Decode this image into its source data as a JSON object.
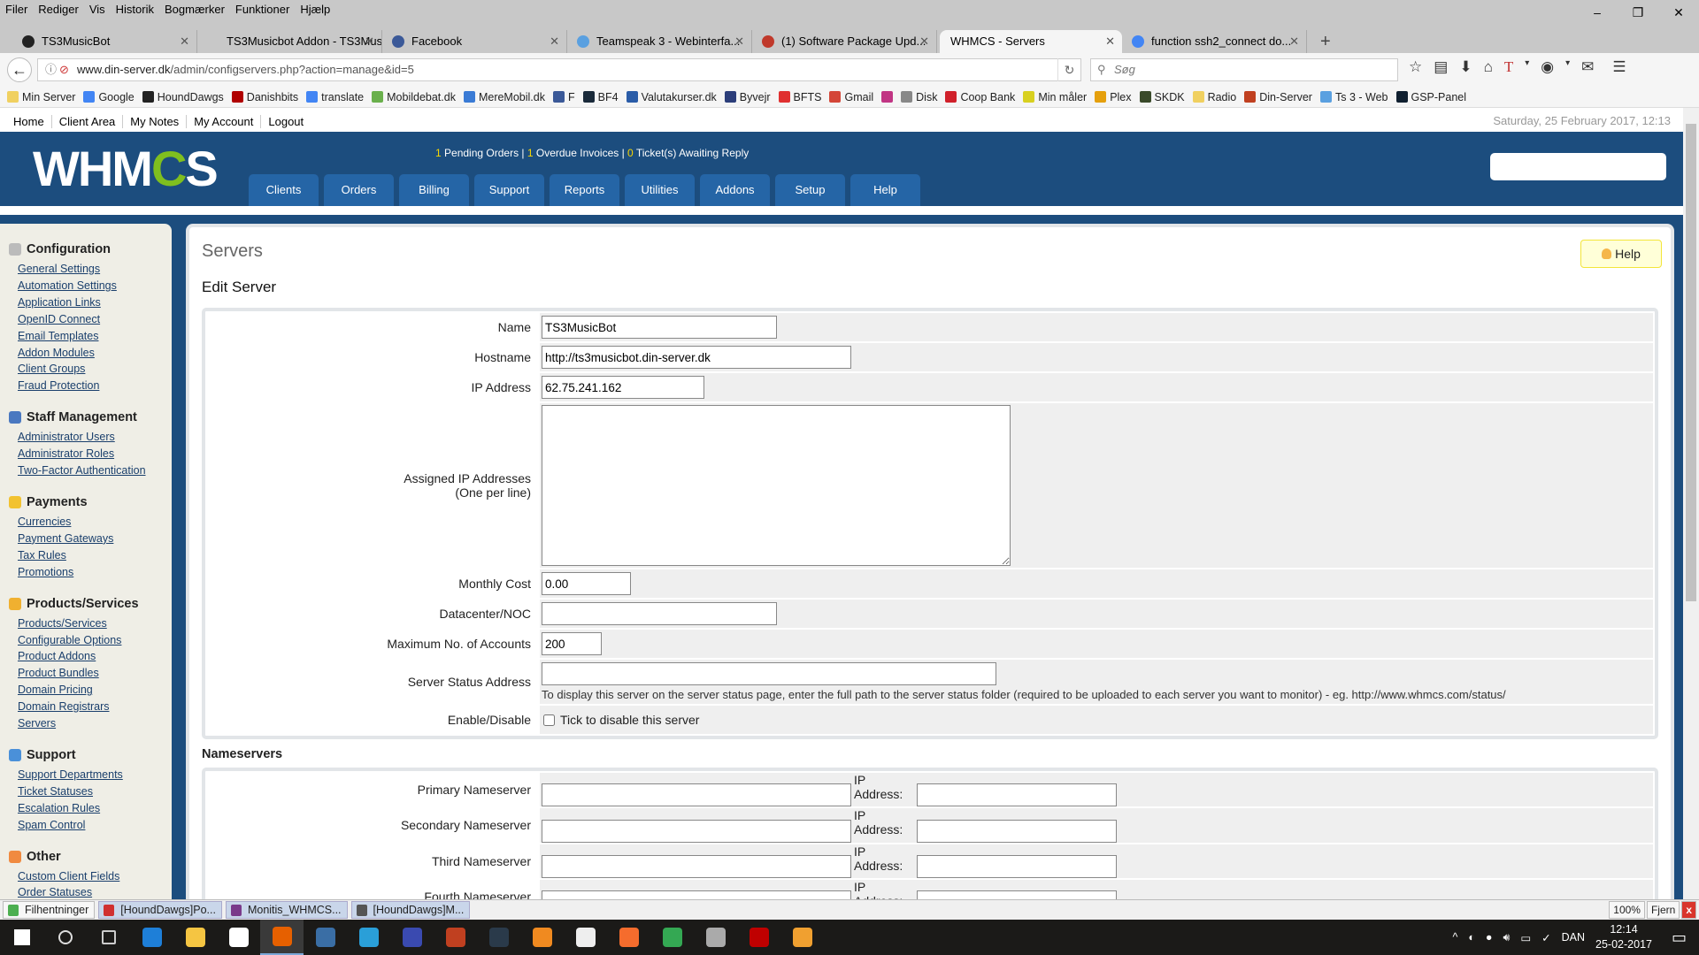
{
  "browser": {
    "menu": [
      "Filer",
      "Rediger",
      "Vis",
      "Historik",
      "Bogmærker",
      "Funktioner",
      "Hjælp"
    ],
    "window_controls": [
      "–",
      "❐",
      "✕"
    ],
    "tabs": [
      {
        "title": "TS3MusicBot",
        "icon": "ts3musicbot-icon",
        "color": "#222222"
      },
      {
        "title": "TS3Musicbot Addon - TS3Mus...",
        "icon": "page-icon",
        "color": "#c8c8c8"
      },
      {
        "title": "Facebook",
        "icon": "facebook-icon",
        "color": "#3b5998"
      },
      {
        "title": "Teamspeak 3 - Webinterfa...",
        "icon": "teamspeak-icon",
        "color": "#5aa0e0"
      },
      {
        "title": "(1) Software Package Upd...",
        "icon": "package-icon",
        "color": "#c0392b"
      },
      {
        "title": "WHMCS - Servers",
        "icon": "",
        "color": "",
        "active": true
      },
      {
        "title": "function ssh2_connect do...",
        "icon": "google-icon",
        "color": "#4285f4"
      }
    ],
    "new_tab": "+",
    "url_domain": "www.din-server.dk",
    "url_path": "/admin/configservers.php?action=manage&id=5",
    "search_placeholder": "Søg",
    "bookmarks": [
      {
        "label": "Min Server",
        "color": "#f0d060"
      },
      {
        "label": "Google",
        "color": "#4285f4"
      },
      {
        "label": "HoundDawgs",
        "color": "#222222"
      },
      {
        "label": "Danishbits",
        "color": "#b00000"
      },
      {
        "label": "translate",
        "color": "#4285f4"
      },
      {
        "label": "Mobildebat.dk",
        "color": "#6ab04c"
      },
      {
        "label": "MereMobil.dk",
        "color": "#3a7bd5"
      },
      {
        "label": "F",
        "color": "#3b5998"
      },
      {
        "label": "BF4",
        "color": "#1a2a3a"
      },
      {
        "label": "Valutakurser.dk",
        "color": "#2a5ca8"
      },
      {
        "label": "Byvejr",
        "color": "#2c3e7a"
      },
      {
        "label": "BFTS",
        "color": "#e03030"
      },
      {
        "label": "Gmail",
        "color": "#d44638"
      },
      {
        "label": "",
        "color": "#c13584"
      },
      {
        "label": "Disk",
        "color": "#888888"
      },
      {
        "label": "Coop Bank",
        "color": "#d0202a"
      },
      {
        "label": "Min måler",
        "color": "#d8d020"
      },
      {
        "label": "Plex",
        "color": "#e5a00d"
      },
      {
        "label": "SKDK",
        "color": "#3a4a2a"
      },
      {
        "label": "Radio",
        "color": "#f0d060"
      },
      {
        "label": "Din-Server",
        "color": "#c04020"
      },
      {
        "label": "Ts 3 - Web",
        "color": "#5aa0e0"
      },
      {
        "label": "GSP-Panel",
        "color": "#102030"
      }
    ]
  },
  "whmcs": {
    "top_links": [
      "Home",
      "Client Area",
      "My Notes",
      "My Account",
      "Logout"
    ],
    "datetime": "Saturday, 25 February 2017, 12:13",
    "logo": {
      "text_a": "WHM",
      "text_b": "C",
      "text_c": "S"
    },
    "stats": {
      "pending_orders_count": "1",
      "pending_orders_label": " Pending Orders | ",
      "overdue_count": "1",
      "overdue_label": " Overdue Invoices | ",
      "tickets_count": "0",
      "tickets_label": " Ticket(s) Awaiting Reply"
    },
    "nav": [
      "Clients",
      "Orders",
      "Billing",
      "Support",
      "Reports",
      "Utilities",
      "Addons",
      "Setup",
      "Help"
    ],
    "colors": {
      "header": "#1c4d7e",
      "tab": "#2565a6",
      "stat_highlight": "#f7d600"
    },
    "sidebar": [
      {
        "title": "Configuration",
        "icon": "configuration-icon",
        "color": "#bbbbbb",
        "items": [
          "General Settings",
          "Automation Settings",
          "Application Links",
          "OpenID Connect",
          "Email Templates",
          "Addon Modules",
          "Client Groups",
          "Fraud Protection"
        ]
      },
      {
        "title": "Staff Management",
        "icon": "user-icon",
        "color": "#4a78c0",
        "items": [
          "Administrator Users",
          "Administrator Roles",
          "Two-Factor Authentication"
        ]
      },
      {
        "title": "Payments",
        "icon": "coins-icon",
        "color": "#f2c230",
        "items": [
          "Currencies",
          "Payment Gateways",
          "Tax Rules",
          "Promotions"
        ]
      },
      {
        "title": "Products/Services",
        "icon": "box-icon",
        "color": "#f0b030",
        "items": [
          "Products/Services",
          "Configurable Options",
          "Product Addons",
          "Product Bundles",
          "Domain Pricing",
          "Domain Registrars",
          "Servers"
        ]
      },
      {
        "title": "Support",
        "icon": "support-icon",
        "color": "#4a90d9",
        "items": [
          "Support Departments",
          "Ticket Statuses",
          "Escalation Rules",
          "Spam Control"
        ]
      },
      {
        "title": "Other",
        "icon": "wrench-icon",
        "color": "#f08a40",
        "items": [
          "Custom Client Fields",
          "Order Statuses"
        ]
      }
    ],
    "page_title": "Servers",
    "help_button": "Help",
    "subtitle": "Edit Server",
    "form": {
      "name_label": "Name",
      "name_value": "TS3MusicBot",
      "hostname_label": "Hostname",
      "hostname_value": "http://ts3musicbot.din-server.dk",
      "ip_label": "IP Address",
      "ip_value": "62.75.241.162",
      "assigned_label": "Assigned IP Addresses",
      "assigned_sub": "(One per line)",
      "assigned_value": "",
      "cost_label": "Monthly Cost",
      "cost_value": "0.00",
      "datacenter_label": "Datacenter/NOC",
      "datacenter_value": "",
      "max_label": "Maximum No. of Accounts",
      "max_value": "200",
      "status_label": "Server Status Address",
      "status_value": "",
      "status_hint": "To display this server on the server status page, enter the full path to the server status folder (required to be uploaded to each server you want to monitor) - eg. http://www.whmcs.com/status/",
      "enable_label": "Enable/Disable",
      "enable_checkbox": "Tick to disable this server",
      "disabled": false
    },
    "nameservers_title": "Nameservers",
    "nameservers": [
      {
        "label": "Primary Nameserver",
        "value": "",
        "ip_label": "IP Address:",
        "ip": ""
      },
      {
        "label": "Secondary Nameserver",
        "value": "",
        "ip_label": "IP Address:",
        "ip": ""
      },
      {
        "label": "Third Nameserver",
        "value": "",
        "ip_label": "IP Address:",
        "ip": ""
      },
      {
        "label": "Fourth Nameserver",
        "value": "",
        "ip_label": "IP Address:",
        "ip": ""
      },
      {
        "label": "",
        "value": "",
        "ip_label": "",
        "ip": ""
      }
    ]
  },
  "downloads": {
    "items": [
      {
        "label": "Filhentninger",
        "color": "#4caf50"
      },
      {
        "label": "[HoundDawgs]Po...",
        "color": "#d03030"
      },
      {
        "label": "Monitis_WHMCS...",
        "color": "#7a3a8a"
      },
      {
        "label": "[HoundDawgs]M...",
        "color": "#555555"
      }
    ],
    "zoom": "100%",
    "remove": "Fjern",
    "close": "x"
  },
  "taskbar": {
    "apps": [
      {
        "name": "start-icon",
        "color": "#ffffff"
      },
      {
        "name": "search-icon",
        "color": "#dddddd"
      },
      {
        "name": "task-view-icon",
        "color": "#cccccc"
      },
      {
        "name": "edge-icon",
        "color": "#1e7fd8"
      },
      {
        "name": "file-explorer-icon",
        "color": "#f5c542"
      },
      {
        "name": "store-icon",
        "color": "#ffffff"
      },
      {
        "name": "firefox-icon",
        "color": "#e66000",
        "active": true
      },
      {
        "name": "thunderbird-icon",
        "color": "#3a6ea5"
      },
      {
        "name": "internet-explorer-icon",
        "color": "#2a9fd8"
      },
      {
        "name": "save-icon",
        "color": "#3a4ab0"
      },
      {
        "name": "burn-icon",
        "color": "#c04020"
      },
      {
        "name": "teamspeak-icon",
        "color": "#2a3a4a"
      },
      {
        "name": "vlc-icon",
        "color": "#f08a20"
      },
      {
        "name": "calculator-icon",
        "color": "#eeeeee"
      },
      {
        "name": "origin-icon",
        "color": "#f56c2d"
      },
      {
        "name": "chrome-icon",
        "color": "#34a853"
      },
      {
        "name": "headset-icon",
        "color": "#aaaaaa"
      },
      {
        "name": "filezilla-icon",
        "color": "#bf0000"
      },
      {
        "name": "media-player-icon",
        "color": "#f0a030"
      }
    ],
    "tray_chevron": "^",
    "language": "DAN",
    "time": "12:14",
    "date": "25-02-2017"
  }
}
